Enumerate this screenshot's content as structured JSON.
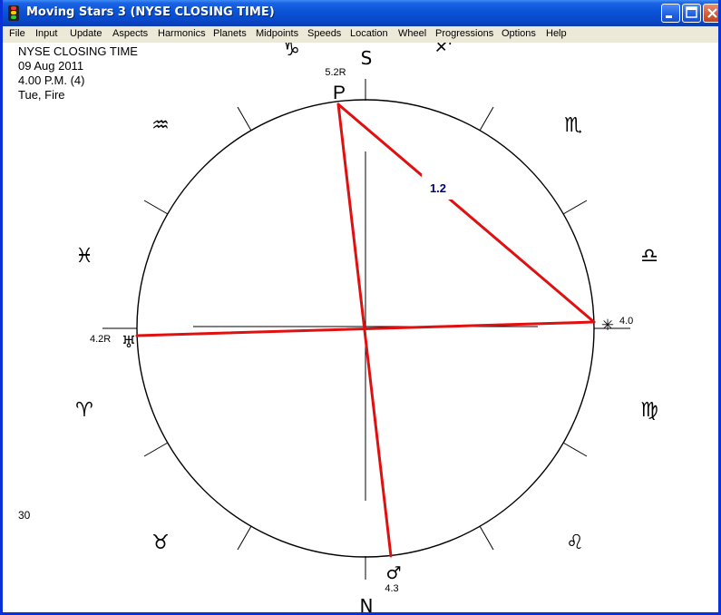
{
  "window": {
    "title": "Moving Stars 3 (NYSE CLOSING TIME)",
    "icon": "traffic-light-icon"
  },
  "title_buttons": {
    "minimize": "minimize-icon",
    "maximize": "maximize-icon",
    "close": "close-icon"
  },
  "menu": [
    "File",
    "Input",
    "Update",
    "Aspects",
    "Harmonics",
    "Planets",
    "Midpoints",
    "Speeds",
    "Location",
    "Wheel",
    "Progressions",
    "Options",
    "Help"
  ],
  "chart_info": {
    "name": "NYSE CLOSING TIME",
    "date": "09 Aug 2011",
    "time": "4.00 P.M. (4)",
    "day": "Tue, Fire",
    "corner_value": "30"
  },
  "wheel": {
    "compass_top": "S",
    "compass_bottom": "N",
    "aspect_label": "1.2",
    "aspect_color": "#e01010",
    "aspect_label_color": "#000080",
    "signs": {
      "capricorn": "♑",
      "sagittarius": "♐",
      "scorpio": "♏",
      "libra": "♎",
      "virgo": "♍",
      "leo": "♌",
      "cancer": "♋",
      "gemini": "♊",
      "taurus": "♉",
      "aries": "♈",
      "pisces": "♓",
      "aquarius": "♒"
    },
    "planets": {
      "pluto": {
        "glyph": "P",
        "value": "5.2R"
      },
      "uranus": {
        "glyph": "♅",
        "value": "4.2R"
      },
      "mars": {
        "glyph": "♂",
        "value": "4.3"
      },
      "star": {
        "glyph": "✳",
        "value": "4.0"
      }
    }
  }
}
